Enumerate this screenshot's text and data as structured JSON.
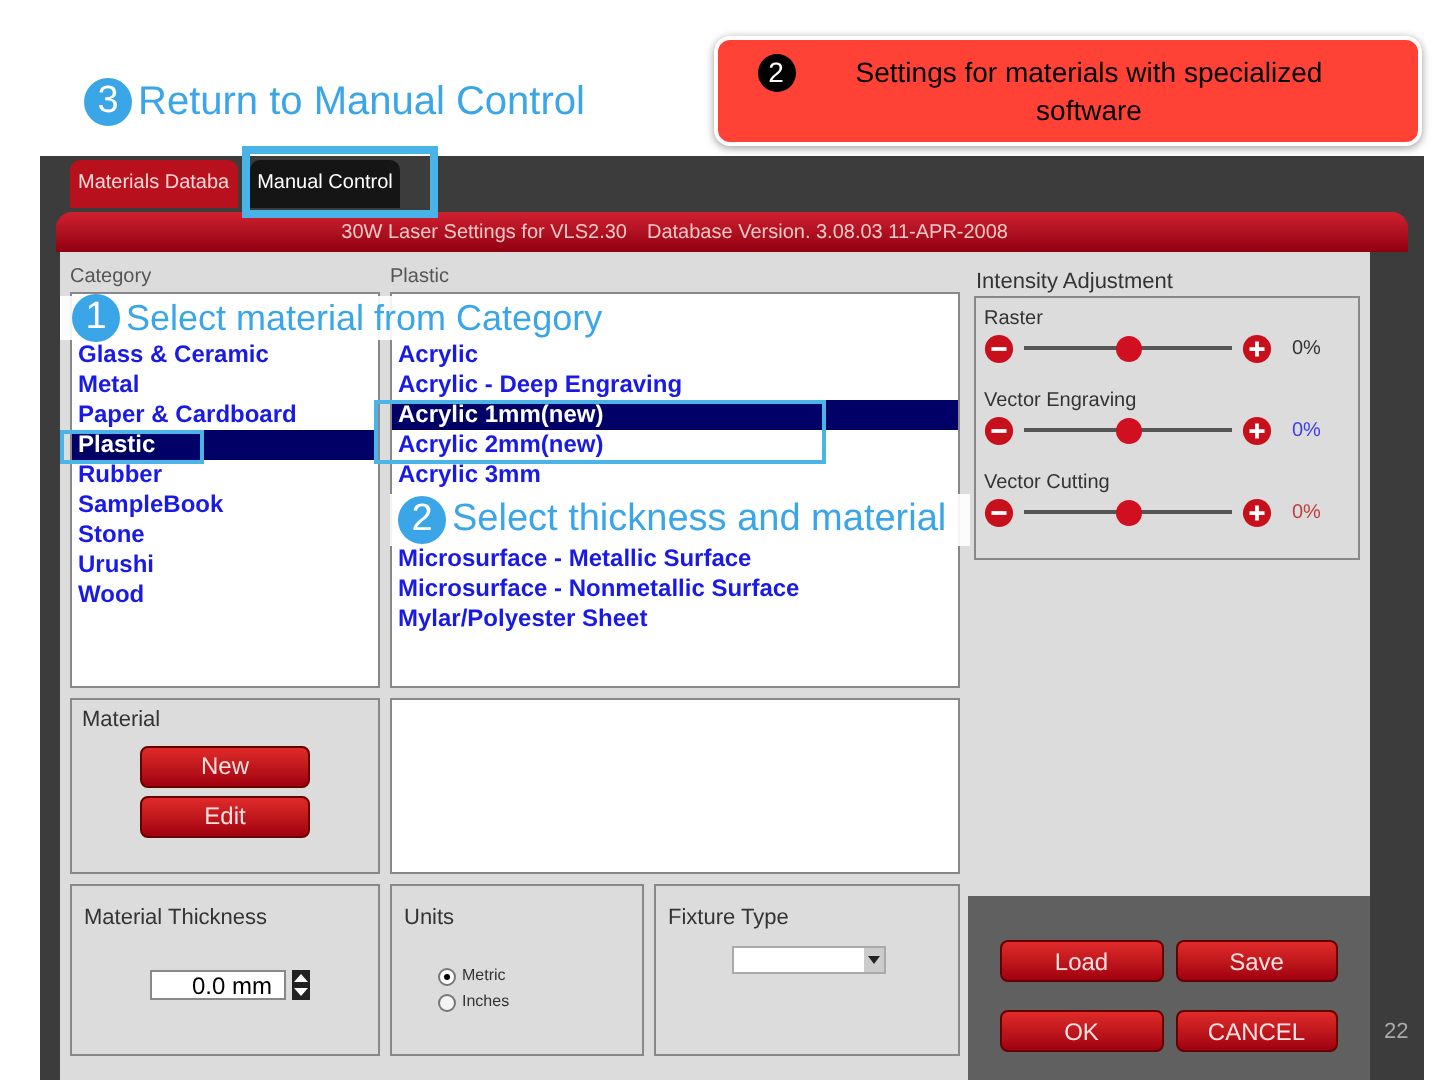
{
  "annotations": {
    "return_label": {
      "number": "3",
      "text": "Return to Manual Control"
    },
    "settings_banner": {
      "number": "2",
      "text": "Settings for materials with specialized software"
    },
    "step_category": {
      "number": "1",
      "text": "Select material from Category"
    },
    "step_thickness": {
      "number": "2",
      "text": "Select thickness and material"
    }
  },
  "tabs": [
    {
      "label": "Materials Databa",
      "selected": true
    },
    {
      "label": "Manual Control",
      "selected": false
    }
  ],
  "header": {
    "title": "30W Laser Settings for VLS2.30",
    "version": "Database Version. 3.08.03 11-APR-2008"
  },
  "category": {
    "heading": "Category",
    "items": [
      {
        "label": "Glass & Ceramic",
        "selected": false
      },
      {
        "label": "Metal",
        "selected": false
      },
      {
        "label": "Paper & Cardboard",
        "selected": false
      },
      {
        "label": "Plastic",
        "selected": true
      },
      {
        "label": "Rubber",
        "selected": false
      },
      {
        "label": "SampleBook",
        "selected": false
      },
      {
        "label": "Stone",
        "selected": false
      },
      {
        "label": "Urushi",
        "selected": false
      },
      {
        "label": "Wood",
        "selected": false
      }
    ]
  },
  "materials": {
    "heading": "Plastic",
    "items": [
      {
        "label": "Acrylic",
        "selected": false
      },
      {
        "label": "Acrylic - Deep Engraving",
        "selected": false
      },
      {
        "label": "Acrylic 1mm(new)",
        "selected": true
      },
      {
        "label": "Acrylic 2mm(new)",
        "selected": false
      },
      {
        "label": "Acrylic 3mm",
        "selected": false
      },
      {
        "label": "Microsurface - Metallic Surface",
        "selected": false
      },
      {
        "label": "Microsurface - Nonmetallic Surface",
        "selected": false
      },
      {
        "label": "Mylar/Polyester Sheet",
        "selected": false
      }
    ]
  },
  "intensity": {
    "title": "Intensity Adjustment",
    "sliders": [
      {
        "label": "Raster",
        "level": 0.5,
        "reading": "0%",
        "color": "#333333"
      },
      {
        "label": "Vector Engraving",
        "level": 0.5,
        "reading": "0%",
        "color": "#4040e0"
      },
      {
        "label": "Vector Cutting",
        "level": 0.5,
        "reading": "0%",
        "color": "#c04040"
      }
    ]
  },
  "material_group": {
    "title": "Material",
    "buttons": [
      "New",
      "Edit"
    ]
  },
  "thickness": {
    "title": "Material Thickness",
    "value": "0.0 mm"
  },
  "units": {
    "title": "Units",
    "options": [
      {
        "label": "Metric",
        "selected": true
      },
      {
        "label": "Inches",
        "selected": false
      }
    ]
  },
  "fixture": {
    "title": "Fixture Type"
  },
  "actions": [
    "Load",
    "Save",
    "OK",
    "CANCEL"
  ],
  "slide_number": "22"
}
